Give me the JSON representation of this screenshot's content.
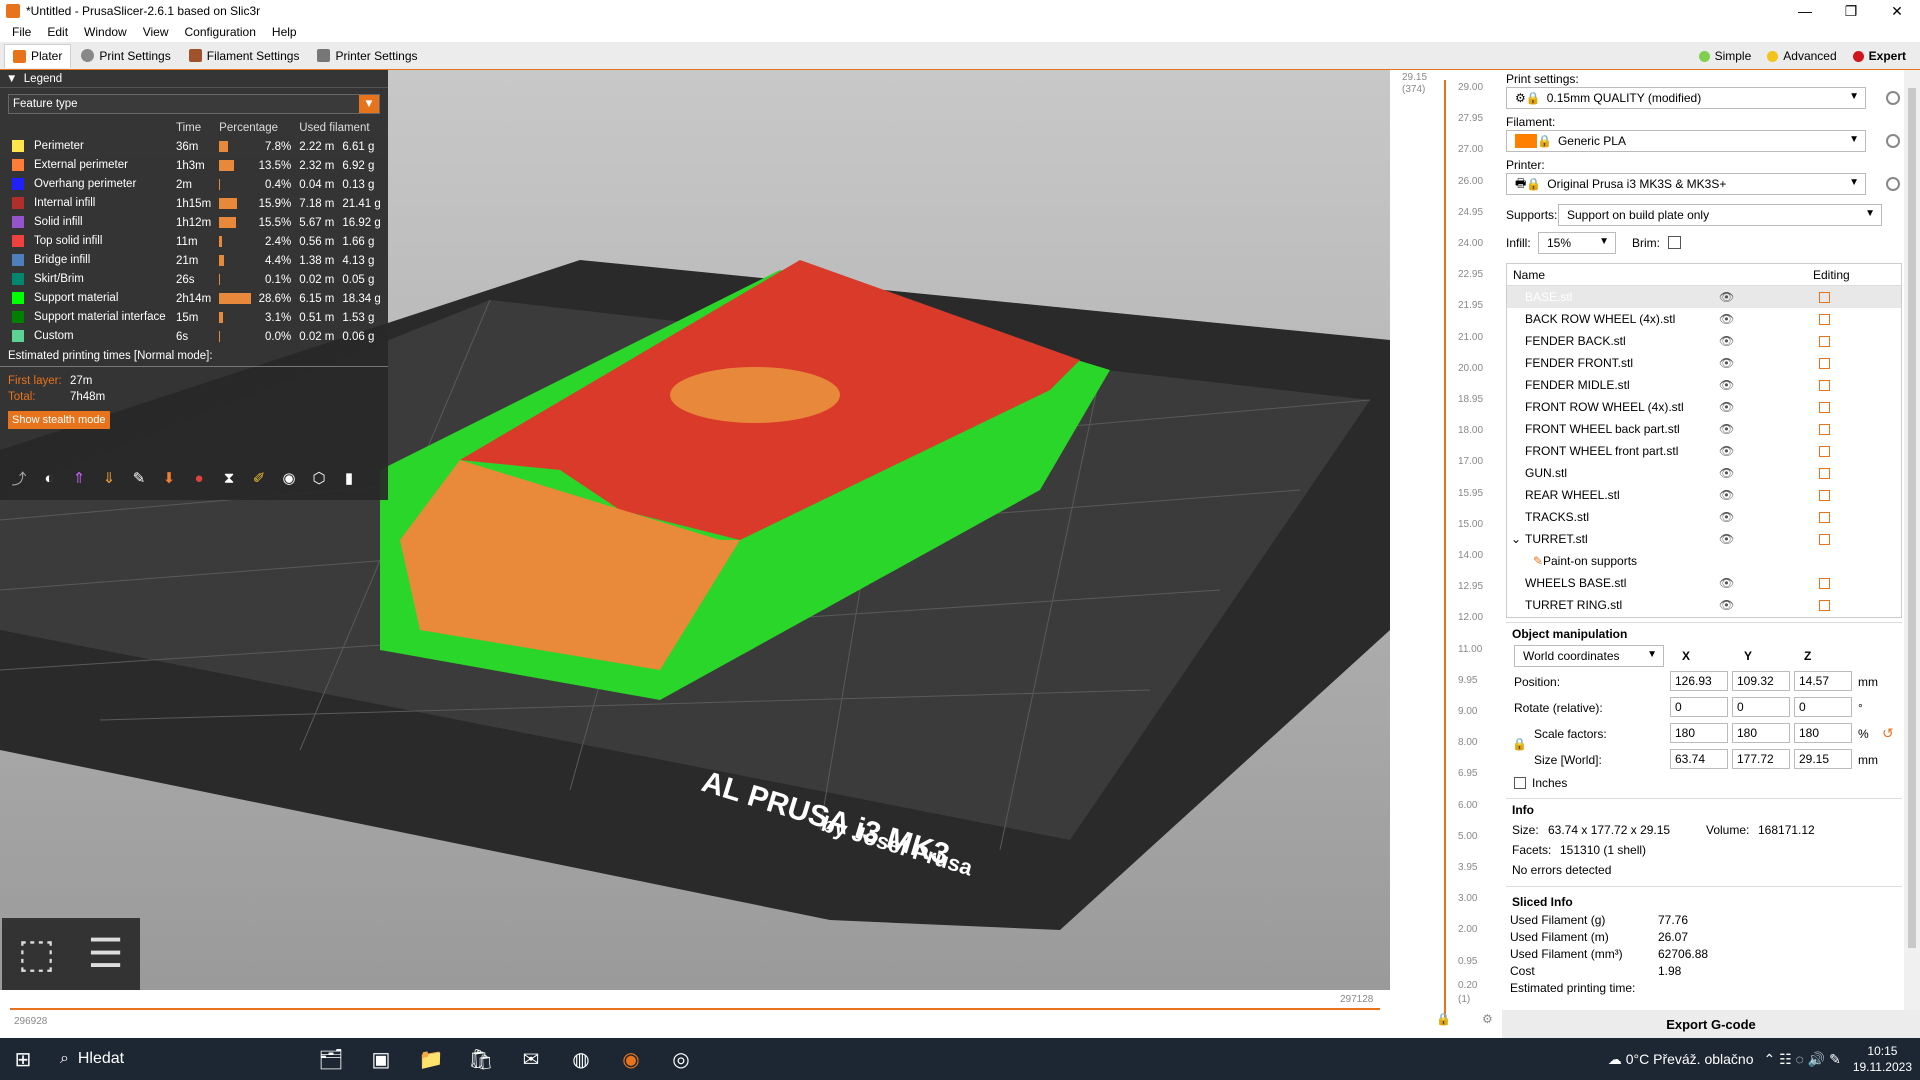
{
  "window": {
    "title": "*Untitled - PrusaSlicer-2.6.1 based on Slic3r",
    "min": "—",
    "max": "❐",
    "close": "✕"
  },
  "menu": [
    "File",
    "Edit",
    "Window",
    "View",
    "Configuration",
    "Help"
  ],
  "tabs": [
    {
      "label": "Plater",
      "color": "#e8731d"
    },
    {
      "label": "Print Settings",
      "color": "#888888"
    },
    {
      "label": "Filament Settings",
      "color": "#a0522d"
    },
    {
      "label": "Printer Settings",
      "color": "#777777"
    }
  ],
  "modes": [
    {
      "label": "Simple",
      "color": "#7fd04f"
    },
    {
      "label": "Advanced",
      "color": "#f2c318"
    },
    {
      "label": "Expert",
      "color": "#d0151b"
    }
  ],
  "legend": {
    "title": "Legend",
    "feature_type": "Feature type",
    "headers": {
      "time": "Time",
      "percentage": "Percentage",
      "used": "Used filament"
    },
    "rows": [
      {
        "name": "Perimeter",
        "color": "#ffe64d",
        "time": "36m",
        "pct": "7.8%",
        "pctv": 7.8,
        "len": "2.22 m",
        "wt": "6.61 g"
      },
      {
        "name": "External perimeter",
        "color": "#ff7d38",
        "time": "1h3m",
        "pct": "13.5%",
        "pctv": 13.5,
        "len": "2.32 m",
        "wt": "6.92 g"
      },
      {
        "name": "Overhang perimeter",
        "color": "#1f1fff",
        "time": "2m",
        "pct": "0.4%",
        "pctv": 0.4,
        "len": "0.04 m",
        "wt": "0.13 g"
      },
      {
        "name": "Internal infill",
        "color": "#b03029",
        "time": "1h15m",
        "pct": "15.9%",
        "pctv": 15.9,
        "len": "7.18 m",
        "wt": "21.41 g"
      },
      {
        "name": "Solid infill",
        "color": "#9654cc",
        "time": "1h12m",
        "pct": "15.5%",
        "pctv": 15.5,
        "len": "5.67 m",
        "wt": "16.92 g"
      },
      {
        "name": "Top solid infill",
        "color": "#f04040",
        "time": "11m",
        "pct": "2.4%",
        "pctv": 2.4,
        "len": "0.56 m",
        "wt": "1.66 g"
      },
      {
        "name": "Bridge infill",
        "color": "#4d80ba",
        "time": "21m",
        "pct": "4.4%",
        "pctv": 4.4,
        "len": "1.38 m",
        "wt": "4.13 g"
      },
      {
        "name": "Skirt/Brim",
        "color": "#00876e",
        "time": "26s",
        "pct": "0.1%",
        "pctv": 0.1,
        "len": "0.02 m",
        "wt": "0.05 g"
      },
      {
        "name": "Support material",
        "color": "#00ff00",
        "time": "2h14m",
        "pct": "28.6%",
        "pctv": 28.6,
        "len": "6.15 m",
        "wt": "18.34 g"
      },
      {
        "name": "Support material interface",
        "color": "#008000",
        "time": "15m",
        "pct": "3.1%",
        "pctv": 3.1,
        "len": "0.51 m",
        "wt": "1.53 g"
      },
      {
        "name": "Custom",
        "color": "#5ed194",
        "time": "6s",
        "pct": "0.0%",
        "pctv": 0.0,
        "len": "0.02 m",
        "wt": "0.06 g"
      }
    ],
    "est_label": "Estimated printing times [Normal mode]:",
    "first_layer_label": "First layer:",
    "first_layer": "27m",
    "total_label": "Total:",
    "total": "7h48m",
    "stealth": "Show stealth mode"
  },
  "bed_text": {
    "line1": "AL PRUSA i3 MK3",
    "line2": "by Josef Prusa"
  },
  "hslider": {
    "left": "296928",
    "right": "297128"
  },
  "vslider": {
    "top_val": "29.15",
    "top_idx": "(374)",
    "bottom_val": "0.20",
    "bottom_idx": "(1)",
    "ticks": [
      "29.00",
      "27.95",
      "27.00",
      "26.00",
      "24.95",
      "24.00",
      "22.95",
      "21.95",
      "21.00",
      "20.00",
      "18.95",
      "18.00",
      "17.00",
      "15.95",
      "15.00",
      "14.00",
      "12.95",
      "12.00",
      "11.00",
      "9.95",
      "9.00",
      "8.00",
      "6.95",
      "6.00",
      "5.00",
      "3.95",
      "3.00",
      "2.00",
      "0.95"
    ]
  },
  "print_settings": {
    "label": "Print settings:",
    "value": "0.15mm QUALITY (modified)"
  },
  "filament": {
    "label": "Filament:",
    "value": "Generic PLA",
    "color": "#ff7f00"
  },
  "printer": {
    "label": "Printer:",
    "value": "Original Prusa i3 MK3S & MK3S+"
  },
  "supports": {
    "label": "Supports:",
    "value": "Support on build plate only"
  },
  "infill": {
    "label": "Infill:",
    "value": "15%"
  },
  "brim": {
    "label": "Brim:"
  },
  "objects": {
    "col_name": "Name",
    "col_edit": "Editing",
    "items": [
      {
        "name": "BASE.stl",
        "eye": "👁",
        "sel": true,
        "indent": 0
      },
      {
        "name": "BACK ROW WHEEL (4x).stl",
        "eye": "👁",
        "indent": 0
      },
      {
        "name": "FENDER BACK.stl",
        "eye": "👁",
        "indent": 0
      },
      {
        "name": "FENDER FRONT.stl",
        "eye": "👁",
        "indent": 0
      },
      {
        "name": "FENDER MIDLE.stl",
        "eye": "👁",
        "indent": 0
      },
      {
        "name": "FRONT ROW WHEEL (4x).stl",
        "eye": "👁",
        "indent": 0
      },
      {
        "name": "FRONT WHEEL back part.stl",
        "eye": "👁",
        "indent": 0
      },
      {
        "name": "FRONT WHEEL front part.stl",
        "eye": "👁",
        "indent": 0
      },
      {
        "name": "GUN.stl",
        "eye": "👁",
        "indent": 0
      },
      {
        "name": "REAR WHEEL.stl",
        "eye": "👁",
        "indent": 0
      },
      {
        "name": "TRACKS.stl",
        "eye": "👁",
        "indent": 0
      },
      {
        "name": "TURRET.stl",
        "eye": "👁",
        "indent": 0,
        "expand": "⌄"
      },
      {
        "name": "Paint-on supports",
        "eye": "",
        "indent": 1
      },
      {
        "name": "WHEELS BASE.stl",
        "eye": "👁",
        "indent": 0
      },
      {
        "name": "TURRET RING.stl",
        "eye": "👁",
        "indent": 0
      }
    ]
  },
  "manip": {
    "title": "Object manipulation",
    "coords": "World coordinates",
    "x": "X",
    "y": "Y",
    "z": "Z",
    "position_label": "Position:",
    "position": [
      "126.93",
      "109.32",
      "14.57"
    ],
    "position_unit": "mm",
    "rotate_label": "Rotate (relative):",
    "rotate": [
      "0",
      "0",
      "0"
    ],
    "rotate_unit": "°",
    "scale_label": "Scale factors:",
    "scale": [
      "180",
      "180",
      "180"
    ],
    "scale_unit": "%",
    "size_label": "Size [World]:",
    "size": [
      "63.74",
      "177.72",
      "29.15"
    ],
    "size_unit": "mm",
    "inches": "Inches"
  },
  "info": {
    "title": "Info",
    "size_label": "Size:",
    "size": "63.74 x 177.72 x 29.15",
    "volume_label": "Volume:",
    "volume": "168171.12",
    "facets_label": "Facets:",
    "facets": "151310 (1 shell)",
    "errors": "No errors detected"
  },
  "sliced": {
    "title": "Sliced Info",
    "rows": [
      {
        "k": "Used Filament (g)",
        "v": "77.76"
      },
      {
        "k": "Used Filament (m)",
        "v": "26.07"
      },
      {
        "k": "Used Filament (mm³)",
        "v": "62706.88"
      },
      {
        "k": "Cost",
        "v": "1.98"
      },
      {
        "k": "Estimated printing time:",
        "v": ""
      }
    ]
  },
  "export": "Export G-code",
  "taskbar": {
    "search": "Hledat",
    "weather": "0°C  Převáž. oblačno",
    "time": "10:15",
    "date": "19.11.2023"
  }
}
